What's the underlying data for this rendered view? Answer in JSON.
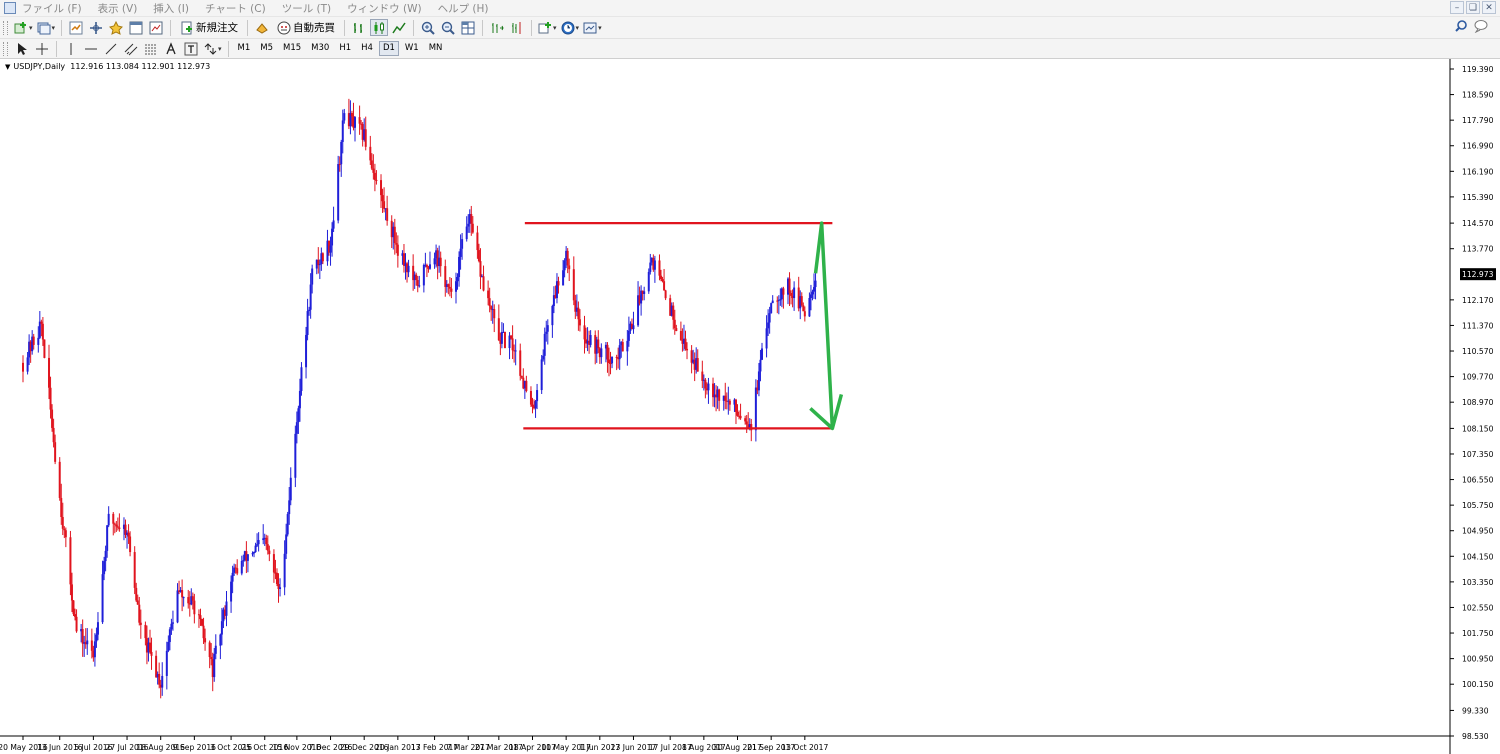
{
  "menu": {
    "items": [
      "ファイル (F)",
      "表示 (V)",
      "挿入 (I)",
      "チャート (C)",
      "ツール (T)",
      "ウィンドウ (W)",
      "ヘルプ (H)"
    ]
  },
  "toolbar": {
    "new_order_label": "新規注文",
    "auto_trade_label": "自動売買",
    "timeframes": [
      "M1",
      "M5",
      "M15",
      "M30",
      "H1",
      "H4",
      "D1",
      "W1",
      "MN"
    ],
    "active_timeframe": "D1"
  },
  "icons": {
    "new-chart": "new-chart-icon",
    "profiles": "profiles-icon",
    "market-watch": "market-watch-icon",
    "data-window": "data-window-icon",
    "navigator": "navigator-icon",
    "terminal": "terminal-icon",
    "tester": "strategy-tester-icon",
    "new-order": "new-order-icon",
    "auto-trade": "auto-trading-icon",
    "bar-chart": "bar-chart-icon",
    "candles": "candlestick-icon",
    "line-chart": "line-chart-icon",
    "zoom-in": "zoom-in-icon",
    "zoom-out": "zoom-out-icon",
    "tile": "tile-windows-icon",
    "autoscroll": "autoscroll-icon",
    "chart-shift": "chart-shift-icon",
    "indicators": "indicators-icon",
    "periods": "periods-clock-icon",
    "templates": "templates-icon",
    "cursor": "cursor-arrow-icon",
    "crosshair": "crosshair-icon",
    "vline": "vertical-line-icon",
    "hline": "horizontal-line-icon",
    "trendline": "trendline-icon",
    "equidistant": "equidistant-channel-icon",
    "fibo": "fibonacci-icon",
    "text": "text-icon",
    "label": "text-label-icon",
    "arrows": "arrows-icon",
    "search": "search-icon",
    "chat": "chat-icon"
  },
  "chart": {
    "symbol_header": "USDJPY,Daily",
    "ohlc": "112.916 113.084 112.901 112.973",
    "current_price_label": "112.973",
    "colors": {
      "bull": "#1f1fd8",
      "bear": "#e0141e",
      "resistance": "#e0141e",
      "support": "#e0141e",
      "arrow": "#2fb24a"
    }
  },
  "chart_data": {
    "type": "candlestick",
    "title": "USDJPY,Daily",
    "price_axis": {
      "ticks": [
        119.39,
        118.59,
        117.79,
        116.99,
        116.19,
        115.39,
        114.57,
        113.77,
        112.17,
        111.37,
        110.57,
        109.77,
        108.97,
        108.15,
        107.35,
        106.55,
        105.75,
        104.95,
        104.15,
        103.35,
        102.55,
        101.75,
        100.95,
        100.15,
        99.33,
        98.53
      ],
      "tick_labels": [
        "119.390",
        "118.590",
        "117.790",
        "116.990",
        "116.190",
        "115.390",
        "114.570",
        "113.770",
        "112.170",
        "111.370",
        "110.570",
        "109.770",
        "108.970",
        "108.150",
        "107.350",
        "106.550",
        "105.750",
        "104.950",
        "104.150",
        "103.350",
        "102.550",
        "101.750",
        "100.950",
        "100.150",
        "99.330",
        "98.530"
      ],
      "range": [
        98.53,
        119.39
      ]
    },
    "time_axis": {
      "labels": [
        "20 May 2016",
        "13 Jun 2016",
        "5 Jul 2016",
        "27 Jul 2016",
        "18 Aug 2016",
        "9 Sep 2016",
        "3 Oct 2016",
        "25 Oct 2016",
        "15 Nov 2016",
        "7 Dec 2016",
        "29 Dec 2016",
        "20 Jan 2017",
        "13 Feb 2017",
        "7 Mar 2017",
        "27 Mar 2017",
        "18 Apr 2017",
        "10 May 2017",
        "1 Jun 2017",
        "23 Jun 2017",
        "17 Jul 2017",
        "8 Aug 2017",
        "30 Aug 2017",
        "21 Sep 2017",
        "13 Oct 2017"
      ]
    },
    "close_path": [
      {
        "date": "20 May 2016",
        "close": 110.2
      },
      {
        "date": "1 Jun 2016",
        "close": 111.4
      },
      {
        "date": "13 Jun 2016",
        "close": 106.0
      },
      {
        "date": "24 Jun 2016",
        "close": 101.8
      },
      {
        "date": "5 Jul 2016",
        "close": 101.1
      },
      {
        "date": "15 Jul 2016",
        "close": 105.3
      },
      {
        "date": "27 Jul 2016",
        "close": 105.0
      },
      {
        "date": "5 Aug 2016",
        "close": 101.8
      },
      {
        "date": "18 Aug 2016",
        "close": 100.2
      },
      {
        "date": "29 Aug 2016",
        "close": 103.0
      },
      {
        "date": "9 Sep 2016",
        "close": 102.6
      },
      {
        "date": "21 Sep 2016",
        "close": 100.6
      },
      {
        "date": "3 Oct 2016",
        "close": 103.5
      },
      {
        "date": "14 Oct 2016",
        "close": 104.2
      },
      {
        "date": "25 Oct 2016",
        "close": 104.6
      },
      {
        "date": "4 Nov 2016",
        "close": 103.0
      },
      {
        "date": "15 Nov 2016",
        "close": 108.5
      },
      {
        "date": "25 Nov 2016",
        "close": 113.0
      },
      {
        "date": "7 Dec 2016",
        "close": 114.0
      },
      {
        "date": "16 Dec 2016",
        "close": 118.0
      },
      {
        "date": "29 Dec 2016",
        "close": 117.3
      },
      {
        "date": "10 Jan 2017",
        "close": 115.2
      },
      {
        "date": "20 Jan 2017",
        "close": 113.8
      },
      {
        "date": "1 Feb 2017",
        "close": 112.6
      },
      {
        "date": "13 Feb 2017",
        "close": 113.7
      },
      {
        "date": "24 Feb 2017",
        "close": 112.2
      },
      {
        "date": "7 Mar 2017",
        "close": 114.8
      },
      {
        "date": "17 Mar 2017",
        "close": 112.6
      },
      {
        "date": "27 Mar 2017",
        "close": 111.0
      },
      {
        "date": "6 Apr 2017",
        "close": 110.7
      },
      {
        "date": "18 Apr 2017",
        "close": 108.6
      },
      {
        "date": "28 Apr 2017",
        "close": 111.5
      },
      {
        "date": "10 May 2017",
        "close": 113.7
      },
      {
        "date": "19 May 2017",
        "close": 111.2
      },
      {
        "date": "1 Jun 2017",
        "close": 110.6
      },
      {
        "date": "12 Jun 2017",
        "close": 110.3
      },
      {
        "date": "23 Jun 2017",
        "close": 111.6
      },
      {
        "date": "5 Jul 2017",
        "close": 113.5
      },
      {
        "date": "17 Jul 2017",
        "close": 111.9
      },
      {
        "date": "27 Jul 2017",
        "close": 110.7
      },
      {
        "date": "8 Aug 2017",
        "close": 109.7
      },
      {
        "date": "18 Aug 2017",
        "close": 109.2
      },
      {
        "date": "30 Aug 2017",
        "close": 108.7
      },
      {
        "date": "8 Sep 2017",
        "close": 108.3
      },
      {
        "date": "21 Sep 2017",
        "close": 112.2
      },
      {
        "date": "2 Oct 2017",
        "close": 112.6
      },
      {
        "date": "13 Oct 2017",
        "close": 111.8
      },
      {
        "date": "20 Oct 2017",
        "close": 112.973
      }
    ],
    "annotations": [
      {
        "type": "horizontal-line",
        "name": "resistance",
        "price": 114.57,
        "from": "13 Apr 2017",
        "to": "31 Oct 2017",
        "color": "#e0141e"
      },
      {
        "type": "horizontal-line",
        "name": "support",
        "price": 108.15,
        "from": "12 Apr 2017",
        "to": "31 Oct 2017",
        "color": "#e0141e"
      },
      {
        "type": "arrow",
        "name": "forecast",
        "color": "#2fb24a",
        "points": [
          {
            "date": "20 Oct 2017",
            "price": 113.0
          },
          {
            "date": "24 Oct 2017",
            "price": 114.57
          },
          {
            "date": "31 Oct 2017",
            "price": 108.15
          }
        ]
      }
    ]
  }
}
